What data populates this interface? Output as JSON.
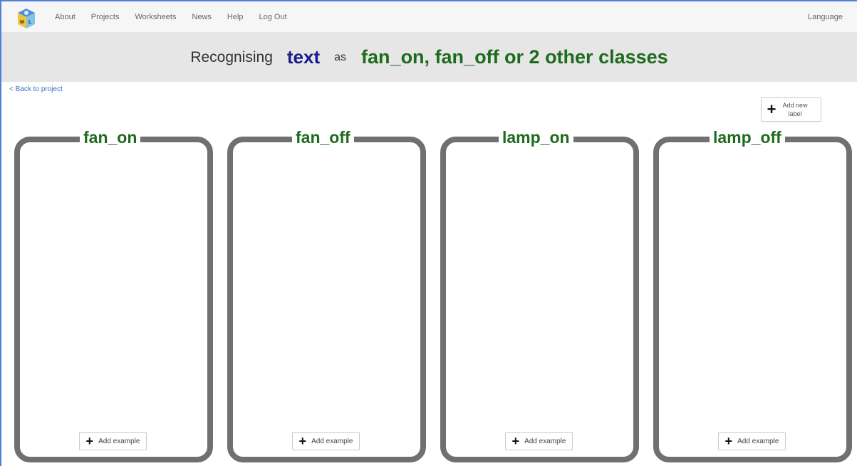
{
  "nav": {
    "items": [
      "About",
      "Projects",
      "Worksheets",
      "News",
      "Help",
      "Log Out"
    ],
    "language": "Language"
  },
  "banner": {
    "recognising": "Recognising",
    "input_type": "text",
    "as": "as",
    "classes": "fan_on, fan_off or 2 other classes"
  },
  "back_link": "< Back to project",
  "add_label": {
    "text": "Add new label"
  },
  "buckets": [
    {
      "title": "fan_on",
      "add_example": "Add example"
    },
    {
      "title": "fan_off",
      "add_example": "Add example"
    },
    {
      "title": "lamp_on",
      "add_example": "Add example"
    },
    {
      "title": "lamp_off",
      "add_example": "Add example"
    }
  ],
  "colors": {
    "label_green": "#1e6b1e",
    "text_blue": "#1a1a8c",
    "bucket_border": "#707070",
    "link_blue": "#3a6fc4"
  },
  "icons": {
    "logo": "mlfk-cube-logo",
    "add": "plus-icon"
  }
}
